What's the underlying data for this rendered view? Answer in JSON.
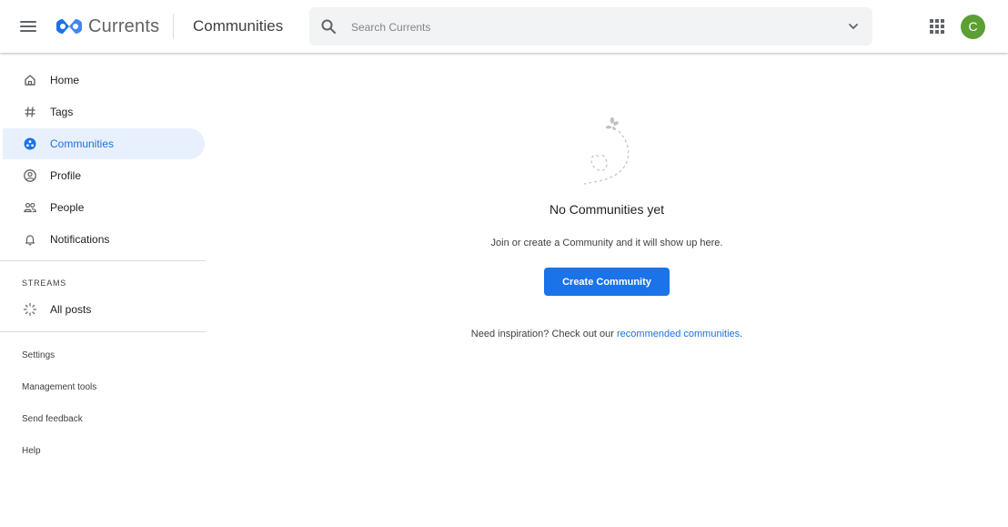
{
  "header": {
    "app_name": "Currents",
    "page_title": "Communities",
    "search_placeholder": "Search Currents",
    "avatar_initial": "C",
    "avatar_color": "#5c9f35",
    "logo_colors": [
      "#1a73e8",
      "#4285f4"
    ]
  },
  "sidebar": {
    "items": [
      {
        "label": "Home",
        "icon": "home-icon",
        "active": false
      },
      {
        "label": "Tags",
        "icon": "hash-icon",
        "active": false
      },
      {
        "label": "Communities",
        "icon": "communities-icon",
        "active": true
      },
      {
        "label": "Profile",
        "icon": "profile-icon",
        "active": false
      },
      {
        "label": "People",
        "icon": "people-icon",
        "active": false
      },
      {
        "label": "Notifications",
        "icon": "bell-icon",
        "active": false
      }
    ],
    "streams_label": "STREAMS",
    "streams": [
      {
        "label": "All posts",
        "icon": "all-posts-icon"
      }
    ],
    "footer_links": [
      "Settings",
      "Management tools",
      "Send feedback",
      "Help"
    ]
  },
  "main": {
    "empty_title": "No Communities yet",
    "empty_description": "Join or create a Community and it will show up here.",
    "create_button": "Create Community",
    "inspiration_text": "Need inspiration? Check out our",
    "inspiration_link": "recommended communities",
    "inspiration_suffix": "."
  },
  "colors": {
    "accent": "#1a73e8",
    "active_bg": "#e8f0fe"
  }
}
